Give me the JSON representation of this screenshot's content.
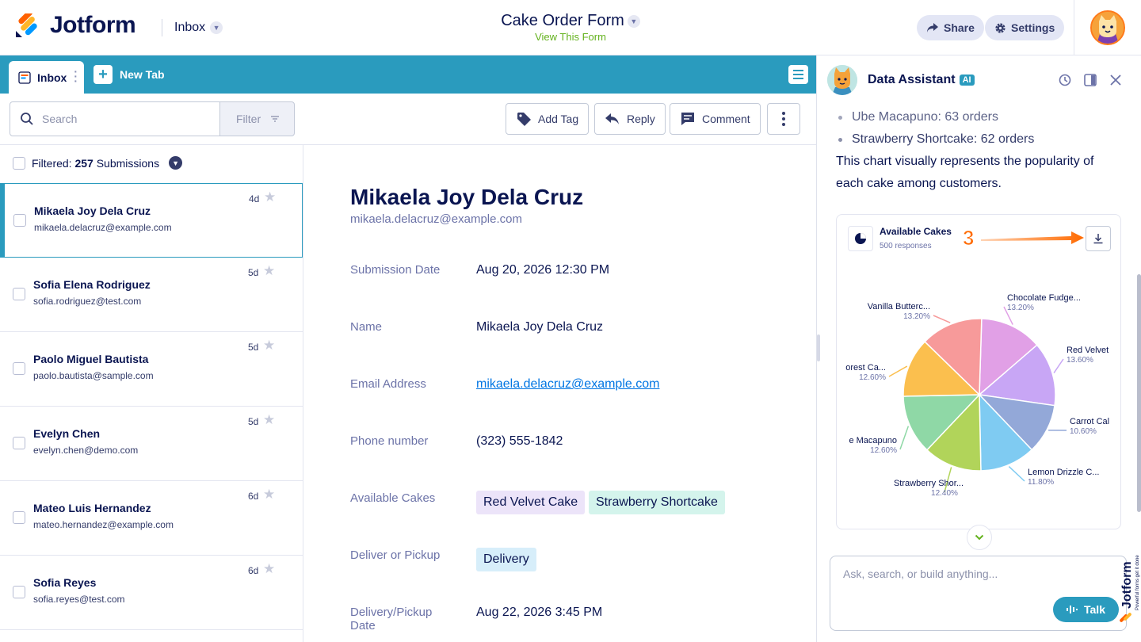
{
  "header": {
    "brand": "Jotform",
    "section": "Inbox",
    "form_title": "Cake Order Form",
    "view_form": "View This Form",
    "share_label": "Share",
    "settings_label": "Settings"
  },
  "tabs": {
    "inbox_label": "Inbox",
    "new_tab_label": "New Tab"
  },
  "toolbar": {
    "search_placeholder": "Search",
    "filter_label": "Filter",
    "add_tag_label": "Add Tag",
    "reply_label": "Reply",
    "comment_label": "Comment"
  },
  "list": {
    "filtered_prefix": "Filtered:",
    "filtered_count": "257",
    "filtered_suffix": "Submissions",
    "items": [
      {
        "name": "Mikaela Joy Dela Cruz",
        "email": "mikaela.delacruz@example.com",
        "age": "4d"
      },
      {
        "name": "Sofia Elena Rodriguez",
        "email": "sofia.rodriguez@test.com",
        "age": "5d"
      },
      {
        "name": "Paolo Miguel Bautista",
        "email": "paolo.bautista@sample.com",
        "age": "5d"
      },
      {
        "name": "Evelyn Chen",
        "email": "evelyn.chen@demo.com",
        "age": "5d"
      },
      {
        "name": "Mateo Luis Hernandez",
        "email": "mateo.hernandez@example.com",
        "age": "6d"
      },
      {
        "name": "Sofia Reyes",
        "email": "sofia.reyes@test.com",
        "age": "6d"
      }
    ]
  },
  "detail": {
    "name": "Mikaela Joy Dela Cruz",
    "email": "mikaela.delacruz@example.com",
    "fields": {
      "submission_date_label": "Submission Date",
      "submission_date": "Aug 20, 2026 12:30 PM",
      "name_label": "Name",
      "name": "Mikaela Joy Dela Cruz",
      "email_label": "Email Address",
      "email": "mikaela.delacruz@example.com",
      "phone_label": "Phone number",
      "phone": "(323) 555-1842",
      "cakes_label": "Available Cakes",
      "cake_1": "Red Velvet Cake",
      "cake_2": "Strawberry Shortcake",
      "delivery_label": "Deliver or Pickup",
      "delivery": "Delivery",
      "date_label_1": "Delivery/Pickup",
      "date_label_2": "Date",
      "date": "Aug 22, 2026 3:45 PM"
    }
  },
  "assistant": {
    "title": "Data Assistant",
    "badge": "AI",
    "bullets": [
      "Ube Macapuno: 63 orders",
      "Strawberry Shortcake: 62 orders"
    ],
    "paragraph_1": "This chart visually represents the popularity of",
    "paragraph_2": "each cake among customers.",
    "chart_title": "Available Cakes",
    "chart_subtitle": "500 responses",
    "step_number": "3",
    "chat_placeholder": "Ask, search, or build anything...",
    "talk_label": "Talk",
    "side_brand": "Jotform",
    "side_tagline": "Powerful forms get it done"
  },
  "chart_data": {
    "type": "pie",
    "title": "Available Cakes",
    "subtitle": "500 responses",
    "slices": [
      {
        "label": "Chocolate Fudge...",
        "pct": "13.20%",
        "value": 13.2,
        "color": "#e1a0e6"
      },
      {
        "label": "Red Velvet",
        "pct": "13.60%",
        "value": 13.6,
        "color": "#c8a6f5"
      },
      {
        "label": "Carrot Cal",
        "pct": "10.60%",
        "value": 10.6,
        "color": "#93a8d8"
      },
      {
        "label": "Lemon Drizzle C...",
        "pct": "11.80%",
        "value": 11.8,
        "color": "#7fcbf2"
      },
      {
        "label": "Strawberry Shor...",
        "pct": "12.40%",
        "value": 12.4,
        "color": "#b1d45a"
      },
      {
        "label": "e Macapuno",
        "pct": "12.60%",
        "value": 12.6,
        "color": "#8fd8a6"
      },
      {
        "label": "orest Ca...",
        "pct": "12.60%",
        "value": 12.6,
        "color": "#fbbf4e"
      },
      {
        "label": "Vanilla Butterc...",
        "pct": "13.20%",
        "value": 13.2,
        "color": "#f79a9a"
      }
    ],
    "legend": "none"
  },
  "colors": {
    "brand_teal": "#2a9bbe",
    "accent_orange": "#ff6a00",
    "link_blue": "#0075e3",
    "green": "#64b21e"
  }
}
